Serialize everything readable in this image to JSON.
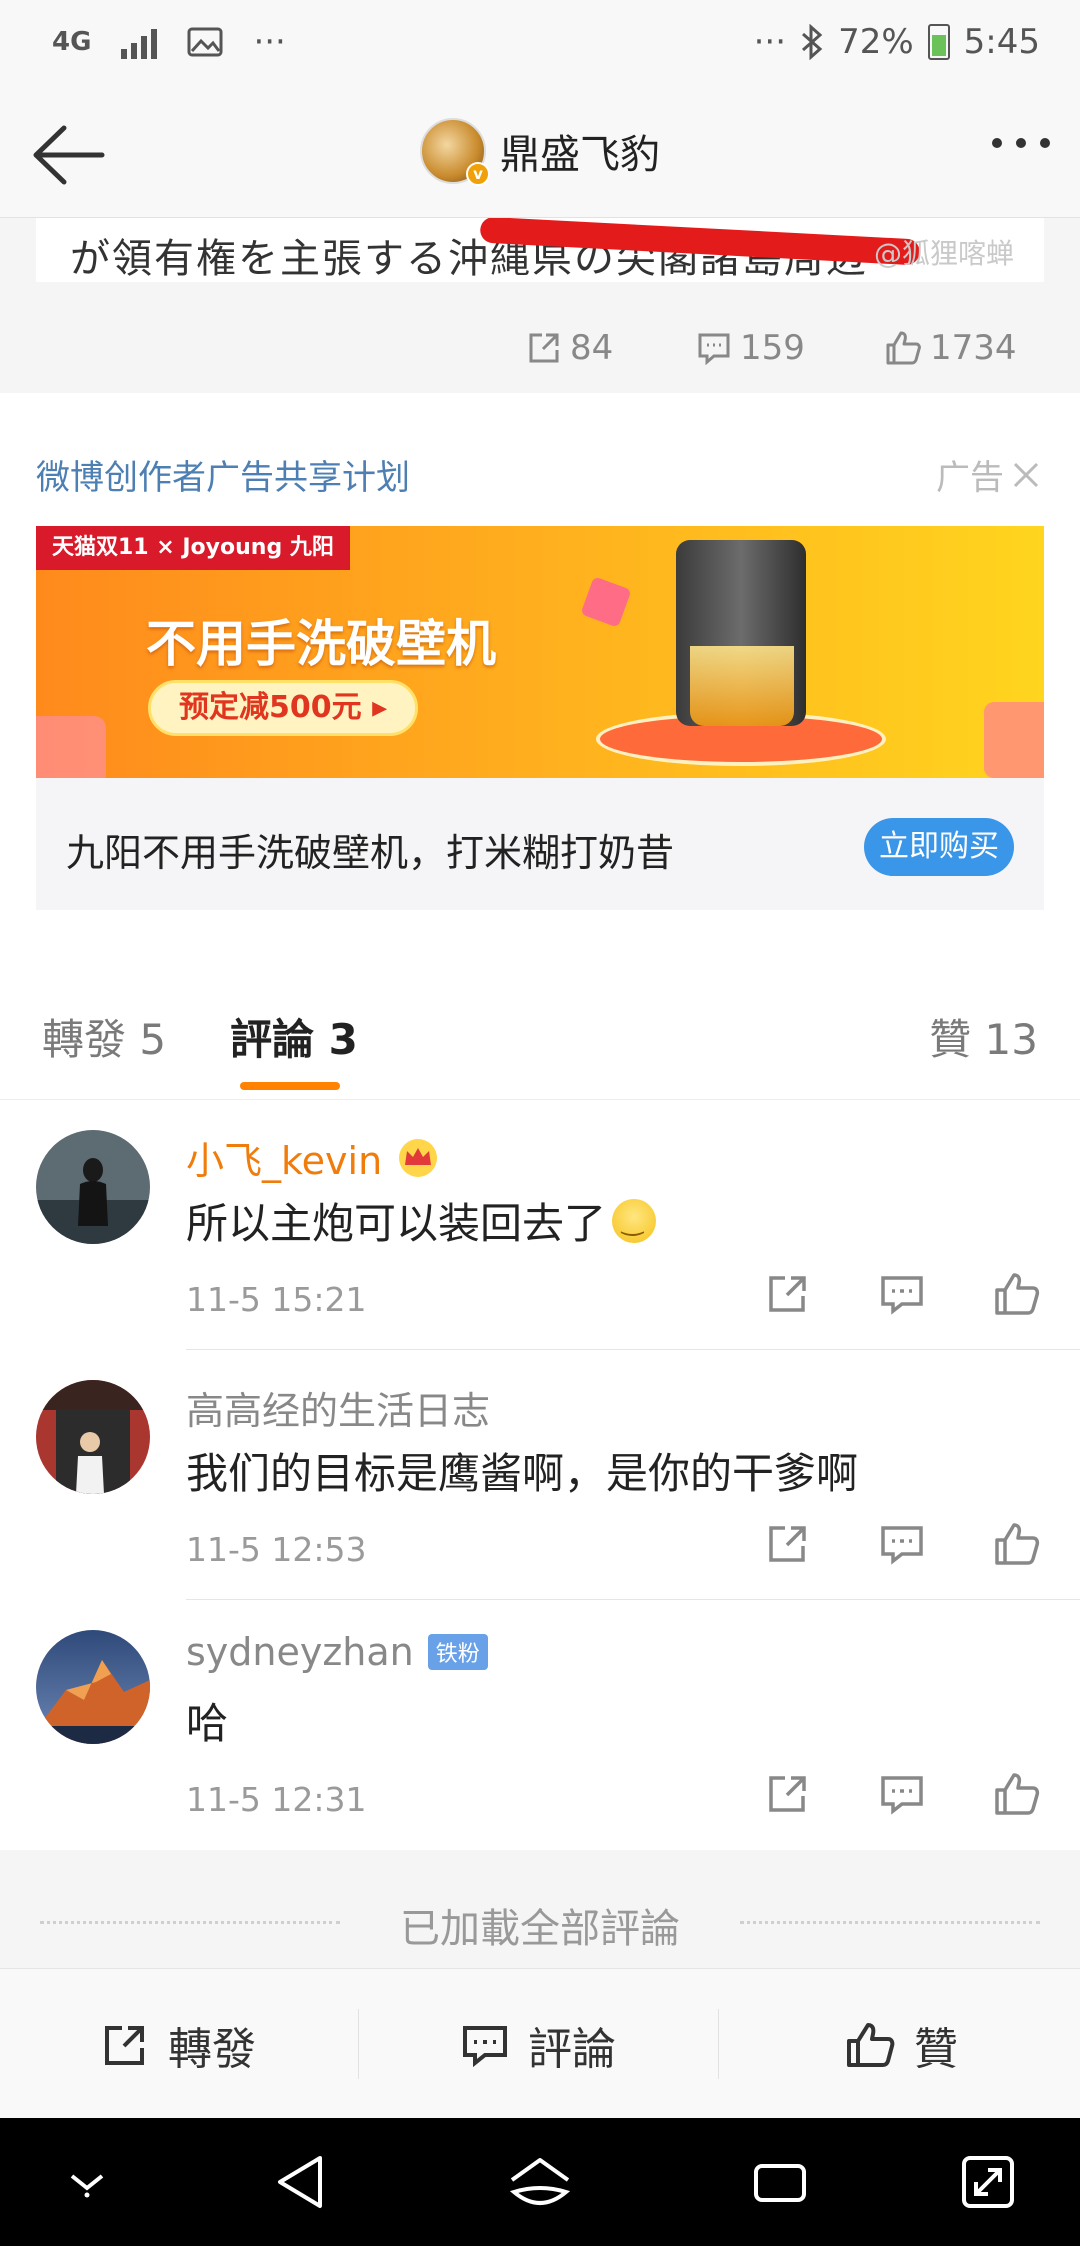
{
  "status_bar": {
    "network": "4G",
    "left_more": "···",
    "right_more": "···",
    "battery": "72%",
    "time": "5:45",
    "icons": [
      "signal-icon",
      "gallery-icon",
      "bluetooth-icon",
      "battery-icon"
    ]
  },
  "header": {
    "title": "鼎盛飞豹",
    "verified_badge": "v",
    "icons": [
      "back-arrow-icon",
      "more-options-icon"
    ]
  },
  "post": {
    "image_text": "が領有権を主張する沖縄県の尖閣諸島周辺",
    "watermark": "@狐狸喀蝉",
    "reposts": "84",
    "comments": "159",
    "likes": "1734"
  },
  "ad": {
    "header": "微博创作者广告共享计划",
    "label": "广告",
    "banner_tag": "天猫双11 × Joyoung 九阳",
    "banner_headline": "不用手洗破壁机",
    "banner_pill": "预定减500元 ▸",
    "description": "九阳不用手洗破壁机，打米糊打奶昔",
    "buy_label": "立即购买"
  },
  "tabs": [
    {
      "label": "轉發 5"
    },
    {
      "label": "評論 3"
    },
    {
      "label": "贊 13"
    }
  ],
  "comments": [
    {
      "user": "小飞_kevin",
      "text": "所以主炮可以装回去了",
      "time": "11-5 15:21",
      "vip": true
    },
    {
      "user": "高高经的生活日志",
      "text": "我们的目标是鹰酱啊，是你的干爹啊",
      "time": "11-5 12:53"
    },
    {
      "user": "sydneyzhan",
      "badge": "铁粉",
      "text": "哈",
      "time": "11-5 12:31"
    }
  ],
  "footer_note": "已加載全部評論",
  "bottom_bar": {
    "repost": "轉發",
    "comment": "評論",
    "like": "贊"
  },
  "colors": {
    "accent_orange": "#ff8200",
    "vip_name": "#f07c0c",
    "ad_link_blue": "#4e7fb3",
    "buy_button_blue": "#3a96e8",
    "redaction_red": "#e41b1b"
  }
}
